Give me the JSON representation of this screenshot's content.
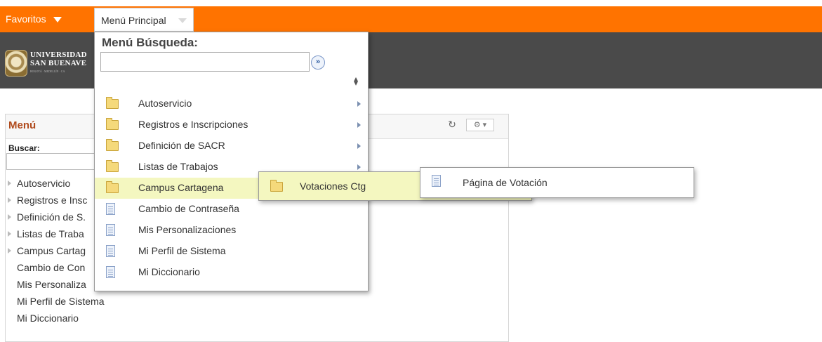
{
  "topbar": {
    "favoritos": "Favoritos",
    "menu_principal": "Menú Principal"
  },
  "banner": {
    "logo_line1": "UNIVERSIDAD",
    "logo_line2": "SAN BUENAVE",
    "logo_line3": "BOGOTÁ · MEDELLÍN · CA"
  },
  "left_panel": {
    "title": "Menú",
    "search_label": "Buscar:",
    "items": [
      {
        "label": "Autoservicio",
        "has_children": true
      },
      {
        "label": "Registros e Insc",
        "has_children": true
      },
      {
        "label": "Definición de S.",
        "has_children": true
      },
      {
        "label": "Listas de Traba",
        "has_children": true
      },
      {
        "label": "Campus Cartag",
        "has_children": true
      },
      {
        "label": "Cambio de Con",
        "has_children": false
      },
      {
        "label": "Mis Personaliza",
        "has_children": false
      },
      {
        "label": "Mi Perfil de Sistema",
        "has_children": false
      },
      {
        "label": "Mi Diccionario",
        "has_children": false
      }
    ]
  },
  "dropdown": {
    "search_title": "Menú Búsqueda:",
    "search_value": "",
    "go_label": "»",
    "items": [
      {
        "label": "Autoservicio",
        "icon": "folder-icon",
        "submenu": true
      },
      {
        "label": "Registros e Inscripciones",
        "icon": "folder-icon",
        "submenu": true
      },
      {
        "label": "Definición de SACR",
        "icon": "folder-icon",
        "submenu": true
      },
      {
        "label": "Listas de Trabajos",
        "icon": "folder-icon",
        "submenu": true
      },
      {
        "label": "Campus Cartagena",
        "icon": "folder-icon",
        "submenu": false,
        "active": true
      },
      {
        "label": "Cambio de Contraseña",
        "icon": "document-icon",
        "submenu": false
      },
      {
        "label": "Mis Personalizaciones",
        "icon": "document-icon",
        "submenu": false
      },
      {
        "label": "Mi Perfil de Sistema",
        "icon": "document-icon",
        "submenu": false
      },
      {
        "label": "Mi Diccionario",
        "icon": "document-icon",
        "submenu": false
      }
    ]
  },
  "flyout_level2": {
    "label": "Votaciones Ctg",
    "icon": "folder-icon"
  },
  "flyout_level3": {
    "label": "Página de Votación",
    "icon": "document-icon"
  },
  "colors": {
    "topbar": "#ff7300",
    "banner": "#4a4a4a",
    "highlight": "#f4f7c0",
    "menu_title": "#b04a1c"
  }
}
